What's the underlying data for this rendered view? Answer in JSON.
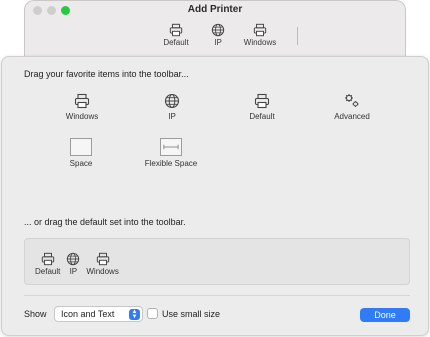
{
  "background_window": {
    "title": "Add Printer",
    "toolbar": [
      {
        "label": "Default",
        "icon": "printer-icon"
      },
      {
        "label": "IP",
        "icon": "globe-icon"
      },
      {
        "label": "Windows",
        "icon": "printer-icon"
      }
    ]
  },
  "sheet": {
    "heading": "Drag your favorite items into the toolbar...",
    "items": [
      {
        "label": "Windows",
        "icon": "printer-icon"
      },
      {
        "label": "IP",
        "icon": "globe-icon"
      },
      {
        "label": "Default",
        "icon": "printer-icon"
      },
      {
        "label": "Advanced",
        "icon": "gears-icon"
      },
      {
        "label": "Space",
        "icon": "space-box-icon"
      },
      {
        "label": "Flexible Space",
        "icon": "flexible-space-icon"
      }
    ],
    "default_heading": "... or drag the default set into the toolbar.",
    "default_set": [
      {
        "label": "Default",
        "icon": "printer-icon"
      },
      {
        "label": "IP",
        "icon": "globe-icon"
      },
      {
        "label": "Windows",
        "icon": "printer-icon"
      }
    ]
  },
  "footer": {
    "show_label": "Show",
    "show_value": "Icon and Text",
    "checkbox_label": "Use small size",
    "checkbox_checked": false,
    "done_label": "Done"
  },
  "colors": {
    "accent": "#2f7cf6",
    "zoom_button": "#28c840"
  }
}
